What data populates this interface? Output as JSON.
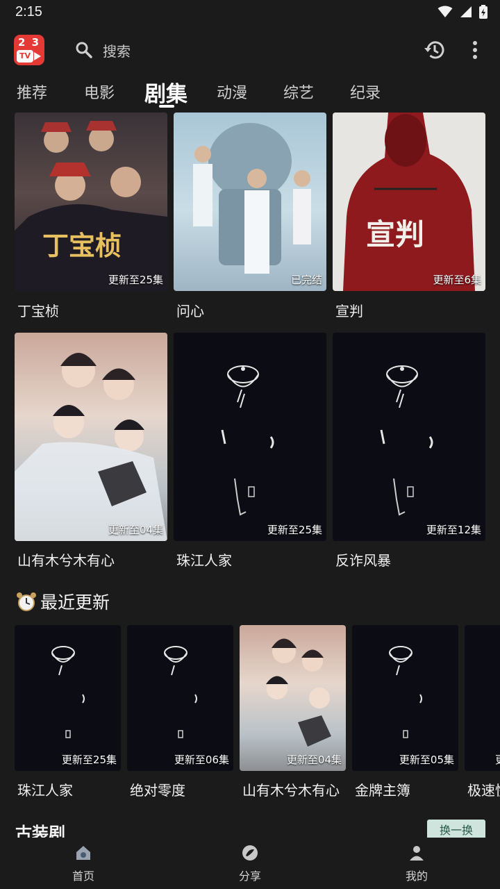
{
  "status": {
    "time": "2:15"
  },
  "header": {
    "search_placeholder": "搜索"
  },
  "tabs": [
    "推荐",
    "电影",
    "剧集",
    "动漫",
    "综艺",
    "纪录"
  ],
  "active_tab": "剧集",
  "grid": [
    {
      "title": "丁宝桢",
      "badge": "更新至25集",
      "poster_text": "丁宝桢"
    },
    {
      "title": "问心",
      "badge": "已完结"
    },
    {
      "title": "宣判",
      "badge": "更新至6集",
      "poster_text": "宣判"
    },
    {
      "title": "山有木兮木有心",
      "badge": "更新至04集"
    },
    {
      "title": "珠江人家",
      "badge": "更新至25集"
    },
    {
      "title": "反诈风暴",
      "badge": "更新至12集"
    }
  ],
  "recent": {
    "section_title": "最近更新",
    "items": [
      {
        "title": "珠江人家",
        "badge": "更新至25集"
      },
      {
        "title": "绝对零度",
        "badge": "更新至06集"
      },
      {
        "title": "山有木兮木有心",
        "badge": "更新至04集"
      },
      {
        "title": "金牌主簿",
        "badge": "更新至05集"
      },
      {
        "title": "极速快",
        "badge": "更新"
      }
    ]
  },
  "next_section": {
    "title": "古装剧",
    "swap_label": "换一换"
  },
  "nav": [
    {
      "label": "首页",
      "icon": "home-icon"
    },
    {
      "label": "分享",
      "icon": "share-icon"
    },
    {
      "label": "我的",
      "icon": "profile-icon"
    }
  ],
  "colors": {
    "background": "#1b1b1b",
    "logo_red": "#e53935",
    "swap_bg": "#cfe4dc"
  }
}
